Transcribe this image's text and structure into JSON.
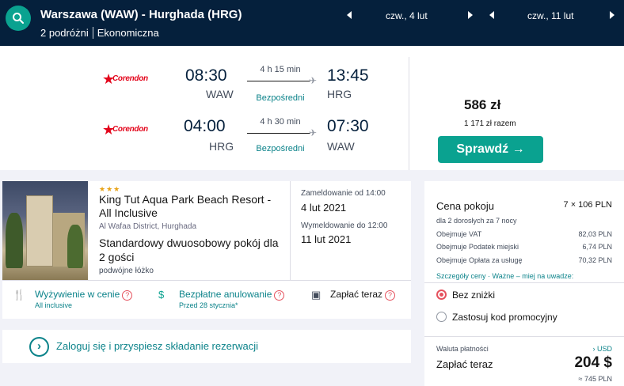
{
  "header": {
    "route": "Warszawa (WAW) - Hurghada (HRG)",
    "travellers": "2 podróżni",
    "cabin": "Ekonomiczna",
    "outbound_date": "czw., 4 lut",
    "return_date": "czw., 11 lut"
  },
  "flights": {
    "airline_name": "Corendon",
    "outbound": {
      "depart_time": "08:30",
      "depart_code": "WAW",
      "arrive_time": "13:45",
      "arrive_code": "HRG",
      "duration": "4 h 15 min",
      "stops": "Bezpośredni"
    },
    "return": {
      "depart_time": "04:00",
      "depart_code": "HRG",
      "arrive_time": "07:30",
      "arrive_code": "WAW",
      "duration": "4 h 30 min",
      "stops": "Bezpośredni"
    },
    "price": "586 zł",
    "price_total": "1 171 zł razem",
    "check_button": "Sprawdź →"
  },
  "hotel": {
    "stars": "★★★",
    "name": "King Tut Aqua Park Beach Resort - All Inclusive",
    "location": "Al Wafaa District, Hurghada",
    "room": "Standardowy dwuosobowy pokój dla 2 gości",
    "bed": "podwójne łóżko",
    "checkin_label": "Zameldowanie od 14:00",
    "checkin_date": "4 lut 2021",
    "checkout_label": "Wymeldowanie do 12:00",
    "checkout_date": "11 lut 2021",
    "features": [
      {
        "title": "Wyżywienie w cenie",
        "sub": "All inclusive",
        "icon": "food-icon"
      },
      {
        "title": "Bezpłatne anulowanie",
        "sub": "Przed 28 stycznia*",
        "icon": "refund-icon"
      },
      {
        "title": "Zapłać teraz",
        "sub": "",
        "icon": "wallet-icon"
      }
    ],
    "help": "?"
  },
  "login": {
    "text": "Zaloguj się i przyspiesz składanie rezerwacji",
    "icon": "›"
  },
  "price_panel": {
    "title": "Cena pokoju",
    "title_value": "7 × 106 PLN",
    "subtitle": "dla 2 dorosłych  za 7 nocy",
    "rows": [
      {
        "label": "Obejmuje VAT",
        "value": "82,03 PLN"
      },
      {
        "label": "Obejmuje Podatek miejski",
        "value": "6,74 PLN"
      },
      {
        "label": "Obejmuje Opłata za usługę",
        "value": "70,32 PLN"
      }
    ],
    "links": "Szczegóły ceny  ·  Ważne – miej na uwadze:",
    "discount_none": "Bez zniżki",
    "discount_code": "Zastosuj kod promocyjny",
    "currency_label": "Waluta płatności",
    "currency_value": "› USD",
    "pay_label": "Zapłać teraz",
    "pay_value": "204 $",
    "pay_approx": "≈ 745 PLN"
  },
  "colors": {
    "navy": "#05203c",
    "teal": "#0aa290",
    "airline_red": "#e3051b",
    "radio_red": "#e5525e"
  }
}
